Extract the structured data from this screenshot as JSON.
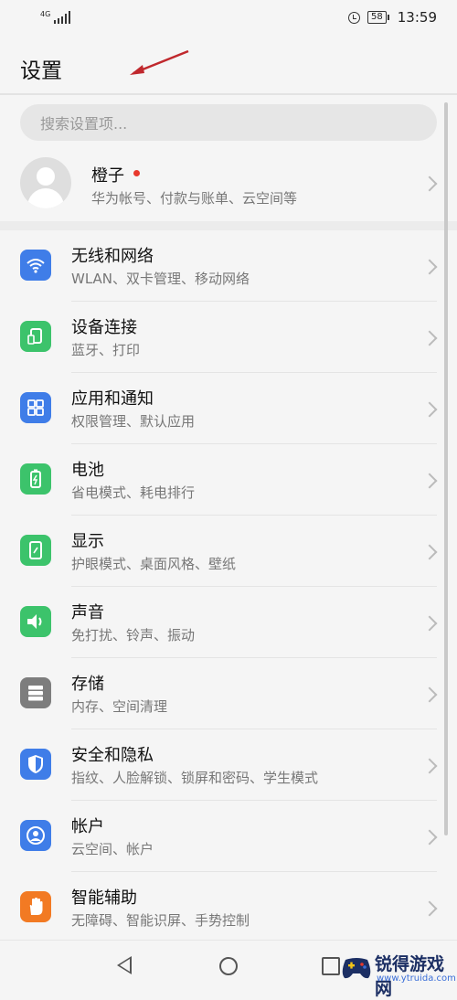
{
  "status_bar": {
    "network": "4G",
    "battery": "58",
    "time": "13:59"
  },
  "header": {
    "title": "设置"
  },
  "search": {
    "placeholder": "搜索设置项..."
  },
  "account": {
    "name": "橙子",
    "subtitle": "华为帐号、付款与账单、云空间等"
  },
  "settings_items": [
    {
      "title": "无线和网络",
      "subtitle": "WLAN、双卡管理、移动网络",
      "icon": "wifi-icon",
      "color": "#3f7de8"
    },
    {
      "title": "设备连接",
      "subtitle": "蓝牙、打印",
      "icon": "device-connect-icon",
      "color": "#3cc36b"
    },
    {
      "title": "应用和通知",
      "subtitle": "权限管理、默认应用",
      "icon": "apps-icon",
      "color": "#3f7de8"
    },
    {
      "title": "电池",
      "subtitle": "省电模式、耗电排行",
      "icon": "battery-icon",
      "color": "#3cc36b"
    },
    {
      "title": "显示",
      "subtitle": "护眼模式、桌面风格、壁纸",
      "icon": "display-icon",
      "color": "#3cc36b"
    },
    {
      "title": "声音",
      "subtitle": "免打扰、铃声、振动",
      "icon": "speaker-icon",
      "color": "#3cc36b"
    },
    {
      "title": "存储",
      "subtitle": "内存、空间清理",
      "icon": "storage-icon",
      "color": "#7d7d7d"
    },
    {
      "title": "安全和隐私",
      "subtitle": "指纹、人脸解锁、锁屏和密码、学生模式",
      "icon": "shield-icon",
      "color": "#3f7de8"
    },
    {
      "title": "帐户",
      "subtitle": "云空间、帐户",
      "icon": "account-icon",
      "color": "#3f7de8"
    },
    {
      "title": "智能辅助",
      "subtitle": "无障碍、智能识屏、手势控制",
      "icon": "hand-icon",
      "color": "#f27a23"
    }
  ],
  "watermark": {
    "name": "锐得游戏网",
    "url": "www.ytruida.com"
  }
}
